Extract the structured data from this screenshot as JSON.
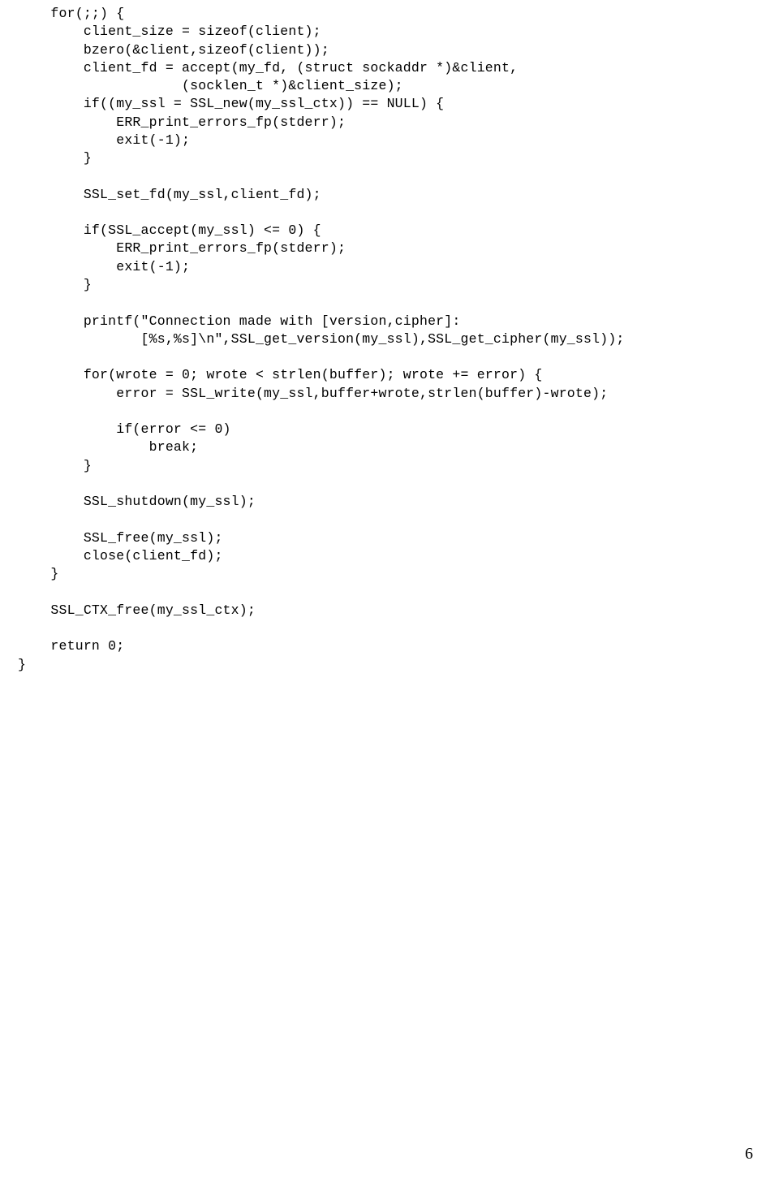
{
  "code": "    for(;;) {\n        client_size = sizeof(client);\n        bzero(&client,sizeof(client));\n        client_fd = accept(my_fd, (struct sockaddr *)&client,\n                    (socklen_t *)&client_size);\n        if((my_ssl = SSL_new(my_ssl_ctx)) == NULL) {\n            ERR_print_errors_fp(stderr);\n            exit(-1);\n        }\n\n        SSL_set_fd(my_ssl,client_fd);\n\n        if(SSL_accept(my_ssl) <= 0) {\n            ERR_print_errors_fp(stderr);\n            exit(-1);\n        }\n\n        printf(\"Connection made with [version,cipher]:\n               [%s,%s]\\n\",SSL_get_version(my_ssl),SSL_get_cipher(my_ssl));\n\n        for(wrote = 0; wrote < strlen(buffer); wrote += error) {\n            error = SSL_write(my_ssl,buffer+wrote,strlen(buffer)-wrote);\n\n            if(error <= 0)\n                break;\n        }\n\n        SSL_shutdown(my_ssl);\n\n        SSL_free(my_ssl);\n        close(client_fd);\n    }\n\n    SSL_CTX_free(my_ssl_ctx);\n\n    return 0;\n}",
  "pageNumber": "6"
}
